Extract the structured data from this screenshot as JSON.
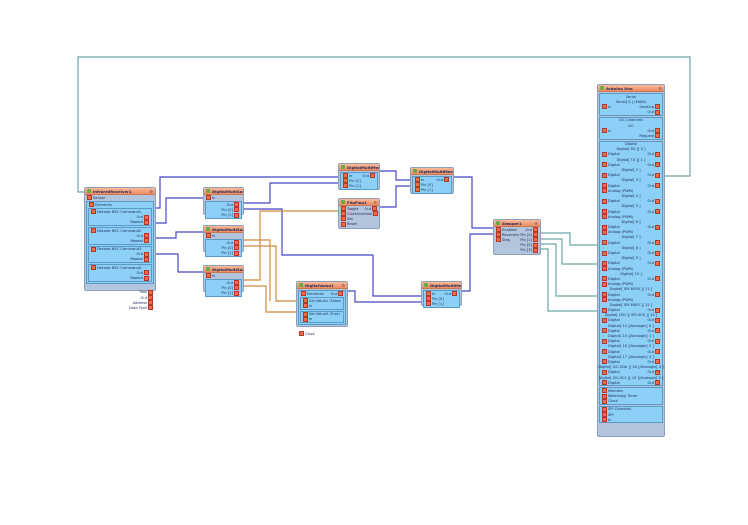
{
  "colors": {
    "wire_digital": "#4646c8",
    "wire_clock": "#d08a3a",
    "wire_teal": "#6aa8a8",
    "header": "#ee8c64",
    "body": "#b3c4dd",
    "panel": "#8dd0f7"
  },
  "components": [
    {
      "id": "ir",
      "title": "InfraredReceiver1",
      "rows": [
        {
          "l": "Sensor"
        },
        {
          "panel": [
            {
              "l": "Elements"
            },
            {
              "panel": [
                {
                  "l": "Decode NEC Command1"
                },
                {
                  "r": "Out"
                },
                {
                  "r": "Repeat"
                }
              ]
            },
            {
              "panel": [
                {
                  "l": "Decode NEC Command2"
                },
                {
                  "r": "Out"
                },
                {
                  "r": "Repeat"
                }
              ]
            },
            {
              "panel": [
                {
                  "l": "Decode NEC Command3"
                },
                {
                  "r": "Out"
                },
                {
                  "r": "Repeat"
                }
              ]
            },
            {
              "panel": [
                {
                  "l": "Decode NEC Command4"
                },
                {
                  "r": "Out"
                },
                {
                  "r": "Repeat"
                }
              ]
            }
          ]
        },
        {
          "r": ""
        },
        {
          "r": "Raw"
        },
        {
          "r": "Out"
        },
        {
          "r": "Address"
        },
        {
          "r": "Data Type"
        }
      ]
    },
    {
      "id": "dms1",
      "title": "DigitalMultiSource1",
      "rows": [
        {
          "l": "In"
        },
        {
          "panel": [
            {
              "r": "Out"
            },
            {
              "r": "Pin [0]"
            },
            {
              "r": "Pin [1]"
            }
          ]
        }
      ]
    },
    {
      "id": "dms2",
      "title": "DigitalMultiSource2",
      "rows": [
        {
          "l": "In"
        },
        {
          "panel": [
            {
              "r": "Out"
            },
            {
              "r": "Pin [0]"
            },
            {
              "r": "Pin [1]"
            }
          ]
        }
      ]
    },
    {
      "id": "dms3",
      "title": "DigitalMultiSource3",
      "rows": [
        {
          "l": "In"
        },
        {
          "panel": [
            {
              "r": "Out"
            },
            {
              "r": "Pin [0]"
            },
            {
              "r": "Pin [1]"
            }
          ]
        }
      ]
    },
    {
      "id": "dmm1",
      "title": "DigitalMultiMerger1",
      "rows": [
        {
          "panel": [
            {
              "l": "In",
              "r": "Out"
            },
            {
              "l": "Pin [0]"
            },
            {
              "l": "Pin [1]"
            }
          ]
        }
      ]
    },
    {
      "id": "ff1",
      "title": "FlipFlop1",
      "rows": [
        {
          "l": "Toggle",
          "r": "Out"
        },
        {
          "l": "Clock",
          "r": "Inverted"
        },
        {
          "l": "Set"
        },
        {
          "l": "Reset"
        }
      ]
    },
    {
      "id": "dmm2",
      "title": "DigitalMultiMerger2",
      "rows": [
        {
          "panel": [
            {
              "l": "In",
              "r": "Out"
            },
            {
              "l": "Pin [0]"
            },
            {
              "l": "Pin [1]"
            }
          ]
        }
      ]
    },
    {
      "id": "dv1",
      "title": "DigitalValue1",
      "rows": [
        {
          "panel": [
            {
              "l": "Elements",
              "r": "Out"
            },
            {
              "panel": [
                {
                  "l": "Set Value1 (False)"
                },
                {
                  "l": "In"
                }
              ]
            },
            {
              "panel": [
                {
                  "l": "Set Value2 (True)"
                },
                {
                  "l": "In"
                }
              ]
            }
          ]
        },
        {
          "l": ""
        },
        {
          "l": "Clock"
        }
      ]
    },
    {
      "id": "dmm3",
      "title": "DigitalMultiMerger3",
      "rows": [
        {
          "panel": [
            {
              "l": "In",
              "r": "Out"
            },
            {
              "l": "Pin [0]"
            },
            {
              "l": "Pin [1]"
            }
          ]
        }
      ]
    },
    {
      "id": "st1",
      "title": "Stepper1",
      "rows": [
        {
          "l": "Enabled",
          "panel": null,
          "r": "Out"
        },
        {
          "l": "Reversed",
          "r": "Pin [0]"
        },
        {
          "l": "Step",
          "r": "Pin [1]"
        },
        {
          "r": "Pin [2]"
        },
        {
          "r": "Pin [3]"
        }
      ]
    },
    {
      "id": "uno",
      "title": "Arduino Uno",
      "rows": [
        {
          "panel": [
            {
              "c": "Serial"
            },
            {
              "c": "Serial[ 0 ] (MAIN)"
            },
            {
              "l": "In",
              "r": "Sending"
            },
            {
              "r": "Out"
            }
          ]
        },
        {
          "panel": [
            {
              "c": "I2C Channels"
            },
            {
              "c": "I2C"
            },
            {
              "l": "In",
              "r": "Out"
            },
            {
              "r": "Request"
            }
          ]
        },
        {
          "panel": [
            {
              "c": "Digital"
            },
            {
              "c": "Digital[ RX ][ 0 ]"
            },
            {
              "l": "Digital",
              "r": "Out"
            },
            {
              "c": "Digital[ TX ][ 1 ]"
            },
            {
              "l": "Digital",
              "r": "Out"
            },
            {
              "c": "Digital[ 2 ]"
            },
            {
              "l": "Digital",
              "r": "Out"
            },
            {
              "c": "Digital[ 3 ]"
            },
            {
              "l": "Digital",
              "r": "Out"
            },
            {
              "l": "Analog (PWM)"
            },
            {
              "c": "Digital[ 4 ]"
            },
            {
              "l": "Digital",
              "r": "Out"
            },
            {
              "c": "Digital[ 5 ]"
            },
            {
              "l": "Digital",
              "r": "Out"
            },
            {
              "l": "Analog (PWM)"
            },
            {
              "c": "Digital[ 6 ]"
            },
            {
              "l": "Digital",
              "r": "Out"
            },
            {
              "l": "Analog (PWM)"
            },
            {
              "c": "Digital[ 7 ]"
            },
            {
              "l": "Digital",
              "r": "Out"
            },
            {
              "c": "Digital[ 8 ]"
            },
            {
              "l": "Digital",
              "r": "Out"
            },
            {
              "c": "Digital[ 9 ]"
            },
            {
              "l": "Digital",
              "r": "Out"
            },
            {
              "l": "Analog (PWM)"
            },
            {
              "c": "Digital[ 10 ]"
            },
            {
              "l": "Digital",
              "r": "Out"
            },
            {
              "l": "Analog (PWM)"
            },
            {
              "c": "Digital[ SPI-MOSI ][ 11 ]"
            },
            {
              "l": "Digital",
              "r": "Out"
            },
            {
              "l": "Analog (PWM)"
            },
            {
              "c": "Digital[ SPI-MISO ][ 12 ]"
            },
            {
              "l": "Digital",
              "r": "Out"
            },
            {
              "c": "Digital[ LED ][ SPI-SCK ][ 13 ]"
            },
            {
              "l": "Digital",
              "r": "Out"
            },
            {
              "c": "Digital[ 14 ]/AnalogIn[ 0 ]"
            },
            {
              "l": "Digital",
              "r": "Out"
            },
            {
              "c": "Digital[ 15 ]/AnalogIn[ 1 ]"
            },
            {
              "l": "Digital",
              "r": "Out"
            },
            {
              "c": "Digital[ 16 ]/AnalogIn[ 2 ]"
            },
            {
              "l": "Digital",
              "r": "Out"
            },
            {
              "c": "Digital[ 17 ]/AnalogIn[ 3 ]"
            },
            {
              "l": "Digital",
              "r": "Out"
            },
            {
              "c": "Digital[ I2C-SDA ][ 18 ]/AnalogIn[ 4 ]"
            },
            {
              "l": "Digital",
              "r": "Out"
            },
            {
              "c": "Digital[ I2C-SCL ][ 19 ]/AnalogIn[ 5 ]"
            },
            {
              "l": "Digital",
              "r": "Out"
            }
          ]
        },
        {
          "panel": [
            {
              "l": "Modules"
            },
            {
              "l": "Watchdog Timer"
            },
            {
              "l": "Clock"
            }
          ]
        },
        {
          "panel": [
            {
              "l": "SPI Channels"
            },
            {
              "l": "SPI"
            },
            {
              "l": "In"
            }
          ]
        }
      ]
    }
  ]
}
